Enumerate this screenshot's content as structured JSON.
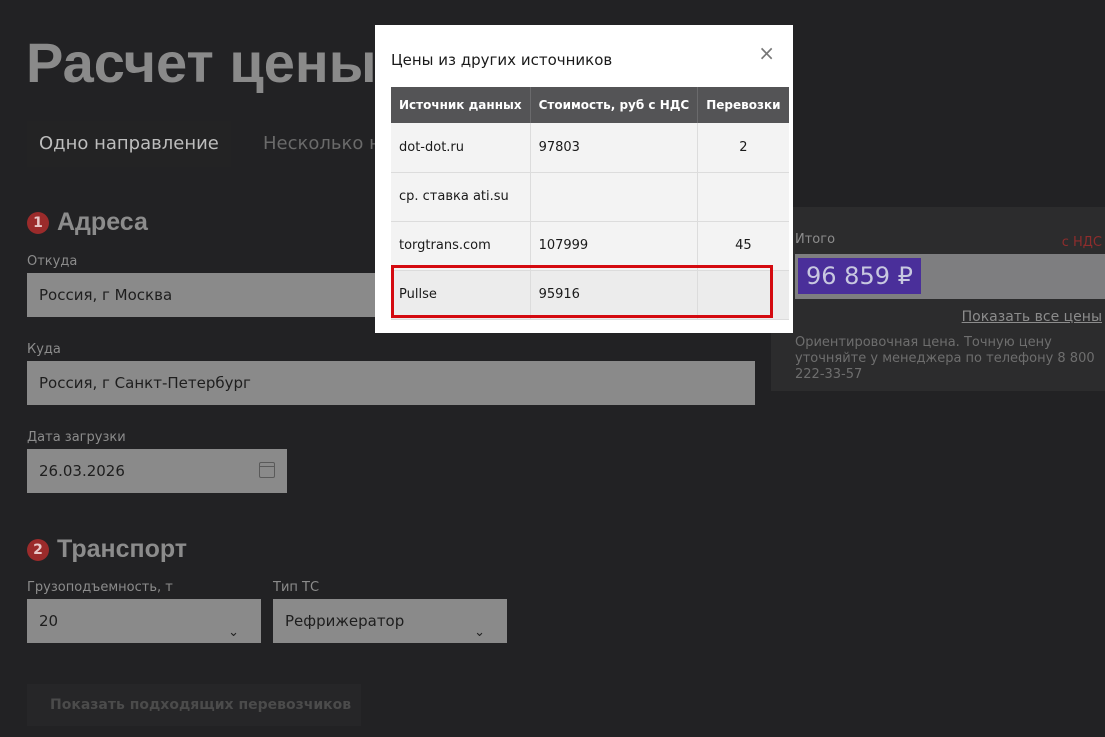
{
  "page": {
    "title": "Расчет цены на перевозку",
    "tabs": [
      "Одно направление",
      "Несколько направлений"
    ]
  },
  "addresses": {
    "number": "1",
    "title": "Адреса",
    "from_label": "Откуда",
    "from_value": "Россия, г Москва",
    "to_label": "Куда",
    "to_value": "Россия, г Санкт-Петербург",
    "date_label": "Дата загрузки",
    "date_value": "26.03.2026"
  },
  "transport": {
    "number": "2",
    "title": "Транспорт",
    "capacity_label": "Грузоподъемность, т",
    "capacity_value": "20",
    "type_label": "Тип ТС",
    "type_value": "Рефрижератор"
  },
  "show_carriers_label": "Показать подходящих перевозчиков",
  "total": {
    "label": "Итого",
    "vat_label": "с НДС",
    "value": "96 859 ₽",
    "all_prices_link": "Показать все цены",
    "note": "Ориентировочная цена. Точную цену уточняйте у менеджера по телефону 8 800 222-33-57"
  },
  "modal": {
    "title": "Цены из других источников",
    "close_symbol": "×",
    "columns": [
      "Источник данных",
      "Стоимость, руб с НДС",
      "Перевозки"
    ],
    "rows": [
      {
        "source": "dot-dot.ru",
        "cost": "97803",
        "count": "2"
      },
      {
        "source": "ср. ставка ati.su",
        "cost": "",
        "count": ""
      },
      {
        "source": "torgtrans.com",
        "cost": "107999",
        "count": "45"
      },
      {
        "source": "Pullse",
        "cost": "95916",
        "count": ""
      }
    ],
    "highlighted_row": "Pullse",
    "highlight_color": "#d40a10"
  }
}
